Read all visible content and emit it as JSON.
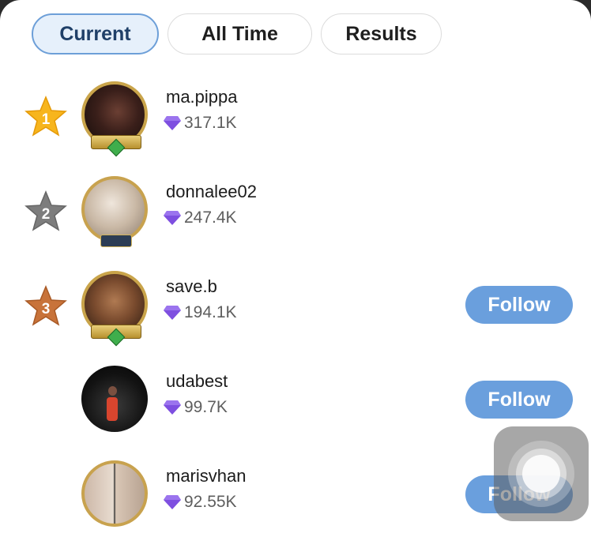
{
  "tabs": [
    {
      "label": "Current",
      "active": true
    },
    {
      "label": "All Time",
      "active": false
    },
    {
      "label": "Results",
      "active": false
    }
  ],
  "entries": [
    {
      "rank": "1",
      "rank_icon": "gold-star-icon",
      "username": "ma.pippa",
      "score": "317.1K",
      "badge": "NOBLE",
      "show_follow": false
    },
    {
      "rank": "2",
      "rank_icon": "gray-star-icon",
      "username": "donnalee02",
      "score": "247.4K",
      "show_follow": false
    },
    {
      "rank": "3",
      "rank_icon": "bronze-star-icon",
      "username": "save.b",
      "score": "194.1K",
      "badge": "GRANDEUR",
      "show_follow": true
    },
    {
      "rank": "",
      "username": "udabest",
      "score": "99.7K",
      "show_follow": true
    },
    {
      "rank": "",
      "username": "marisvhan",
      "score": "92.55K",
      "show_follow": true
    }
  ],
  "follow_label": "Follow",
  "colors": {
    "gold": "#f7b51d",
    "gray": "#7d7d7d",
    "bronze": "#c8733a",
    "follow_button": "#6a9fdd",
    "diamond": "#7e4fe0",
    "active_tab_border": "#6d9fd8"
  }
}
